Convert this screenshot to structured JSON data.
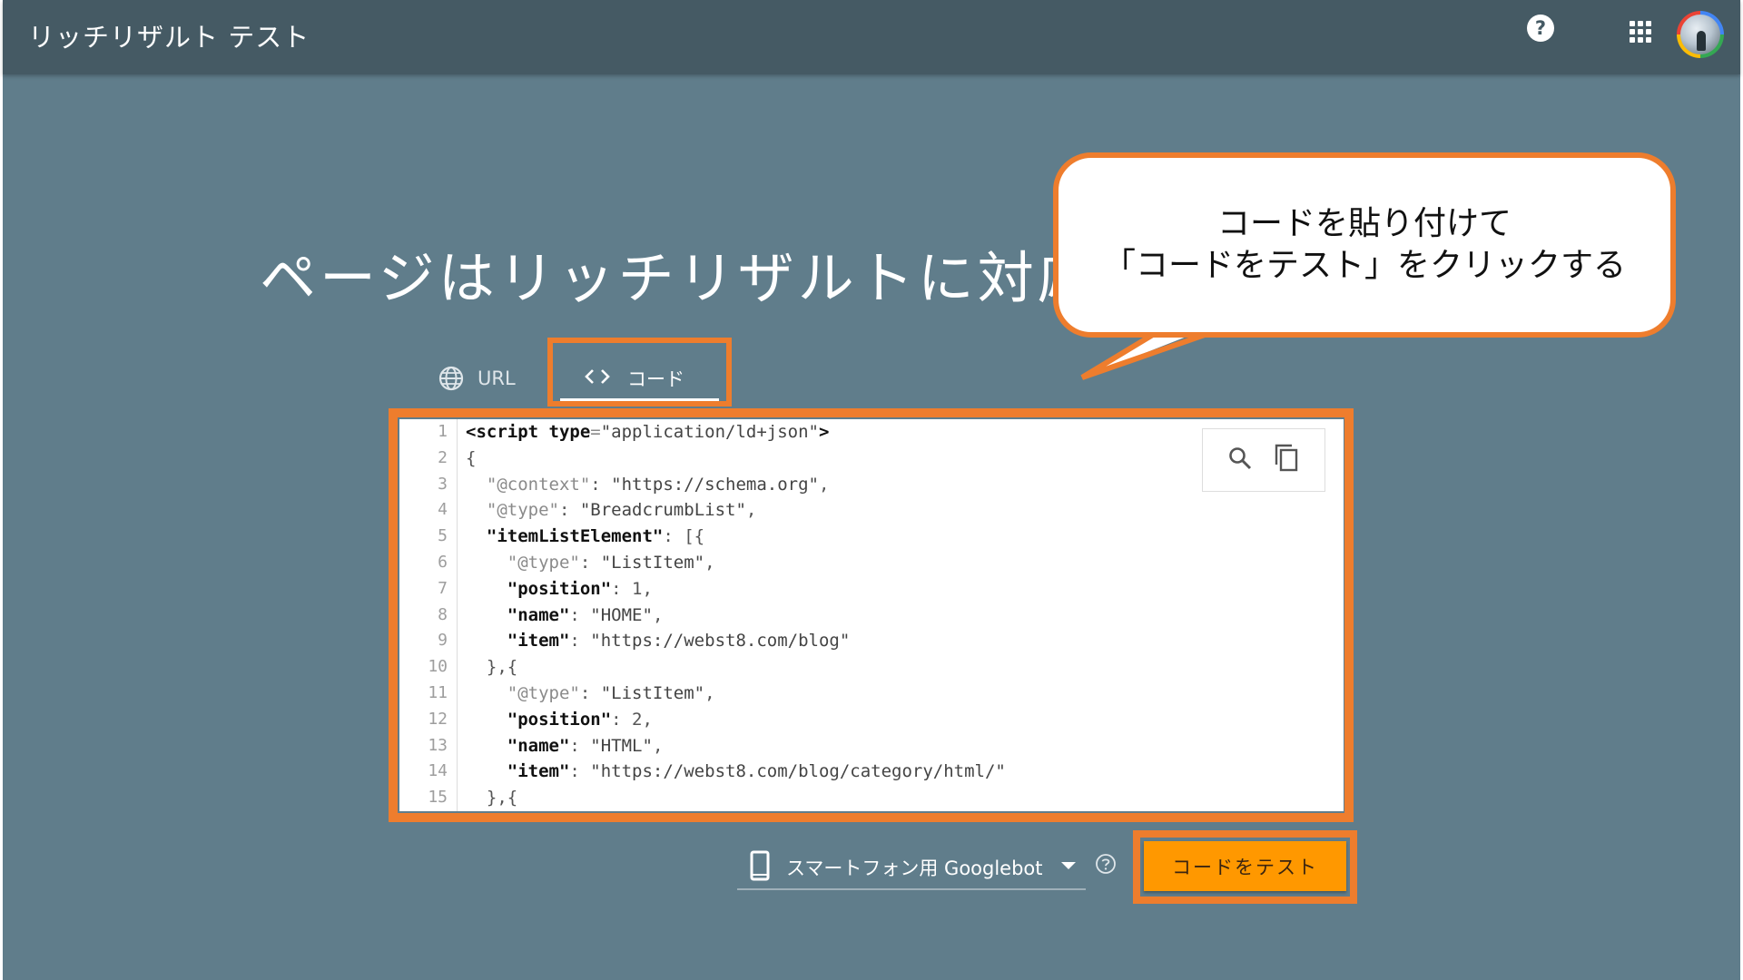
{
  "app": {
    "title": "リッチリザルト テスト"
  },
  "header": {
    "help_icon": "help-icon",
    "help_glyph": "?",
    "apps_icon": "apps-grid-icon",
    "avatar": "account-avatar"
  },
  "main": {
    "headline": "ページはリッチリザルトに対応"
  },
  "tabs": [
    {
      "label": "URL",
      "icon": "globe-icon",
      "selected": false
    },
    {
      "label": "コード",
      "icon": "code-brackets-icon",
      "selected": true
    }
  ],
  "editor": {
    "line_numbers": [
      "1",
      "2",
      "3",
      "4",
      "5",
      "6",
      "7",
      "8",
      "9",
      "10",
      "11",
      "12",
      "13",
      "14",
      "15"
    ],
    "lines": [
      [
        {
          "t": "tag",
          "v": "<script "
        },
        {
          "t": "tag",
          "v": "type"
        },
        {
          "t": "dim",
          "v": "="
        },
        {
          "t": "str",
          "v": "\"application/ld+json\""
        },
        {
          "t": "tag",
          "v": ">"
        }
      ],
      [
        {
          "t": "punc",
          "v": "{"
        }
      ],
      [
        {
          "t": "punc",
          "v": "  "
        },
        {
          "t": "dim",
          "v": "\"@context\""
        },
        {
          "t": "punc",
          "v": ": "
        },
        {
          "t": "str",
          "v": "\"https://schema.org\""
        },
        {
          "t": "punc",
          "v": ","
        }
      ],
      [
        {
          "t": "punc",
          "v": "  "
        },
        {
          "t": "dim",
          "v": "\"@type\""
        },
        {
          "t": "punc",
          "v": ": "
        },
        {
          "t": "str",
          "v": "\"BreadcrumbList\""
        },
        {
          "t": "punc",
          "v": ","
        }
      ],
      [
        {
          "t": "punc",
          "v": "  "
        },
        {
          "t": "key",
          "v": "\"itemListElement\""
        },
        {
          "t": "punc",
          "v": ": [{"
        }
      ],
      [
        {
          "t": "punc",
          "v": "    "
        },
        {
          "t": "dim",
          "v": "\"@type\""
        },
        {
          "t": "punc",
          "v": ": "
        },
        {
          "t": "str",
          "v": "\"ListItem\""
        },
        {
          "t": "punc",
          "v": ","
        }
      ],
      [
        {
          "t": "punc",
          "v": "    "
        },
        {
          "t": "key",
          "v": "\"position\""
        },
        {
          "t": "punc",
          "v": ": 1,"
        }
      ],
      [
        {
          "t": "punc",
          "v": "    "
        },
        {
          "t": "key",
          "v": "\"name\""
        },
        {
          "t": "punc",
          "v": ": "
        },
        {
          "t": "str",
          "v": "\"HOME\""
        },
        {
          "t": "punc",
          "v": ","
        }
      ],
      [
        {
          "t": "punc",
          "v": "    "
        },
        {
          "t": "key",
          "v": "\"item\""
        },
        {
          "t": "punc",
          "v": ": "
        },
        {
          "t": "str",
          "v": "\"https://webst8.com/blog\""
        }
      ],
      [
        {
          "t": "punc",
          "v": "  },{"
        }
      ],
      [
        {
          "t": "punc",
          "v": "    "
        },
        {
          "t": "dim",
          "v": "\"@type\""
        },
        {
          "t": "punc",
          "v": ": "
        },
        {
          "t": "str",
          "v": "\"ListItem\""
        },
        {
          "t": "punc",
          "v": ","
        }
      ],
      [
        {
          "t": "punc",
          "v": "    "
        },
        {
          "t": "key",
          "v": "\"position\""
        },
        {
          "t": "punc",
          "v": ": 2,"
        }
      ],
      [
        {
          "t": "punc",
          "v": "    "
        },
        {
          "t": "key",
          "v": "\"name\""
        },
        {
          "t": "punc",
          "v": ": "
        },
        {
          "t": "str",
          "v": "\"HTML\""
        },
        {
          "t": "punc",
          "v": ","
        }
      ],
      [
        {
          "t": "punc",
          "v": "    "
        },
        {
          "t": "key",
          "v": "\"item\""
        },
        {
          "t": "punc",
          "v": ": "
        },
        {
          "t": "str",
          "v": "\"https://webst8.com/blog/category/html/\""
        }
      ],
      [
        {
          "t": "punc",
          "v": "  },{"
        }
      ]
    ],
    "tools": [
      "search-icon",
      "copy-icon"
    ]
  },
  "controls": {
    "device_label": "スマートフォン用 Googlebot",
    "device_icon": "smartphone-icon",
    "test_button_label": "コードをテスト"
  },
  "annotation": {
    "line1": "コードを貼り付けて",
    "line2": "「コードをテスト」をクリックする"
  },
  "colors": {
    "background": "#607d8b",
    "topbar": "#455a64",
    "accent_outline": "#ee7d2d",
    "test_button": "#ff9800"
  }
}
